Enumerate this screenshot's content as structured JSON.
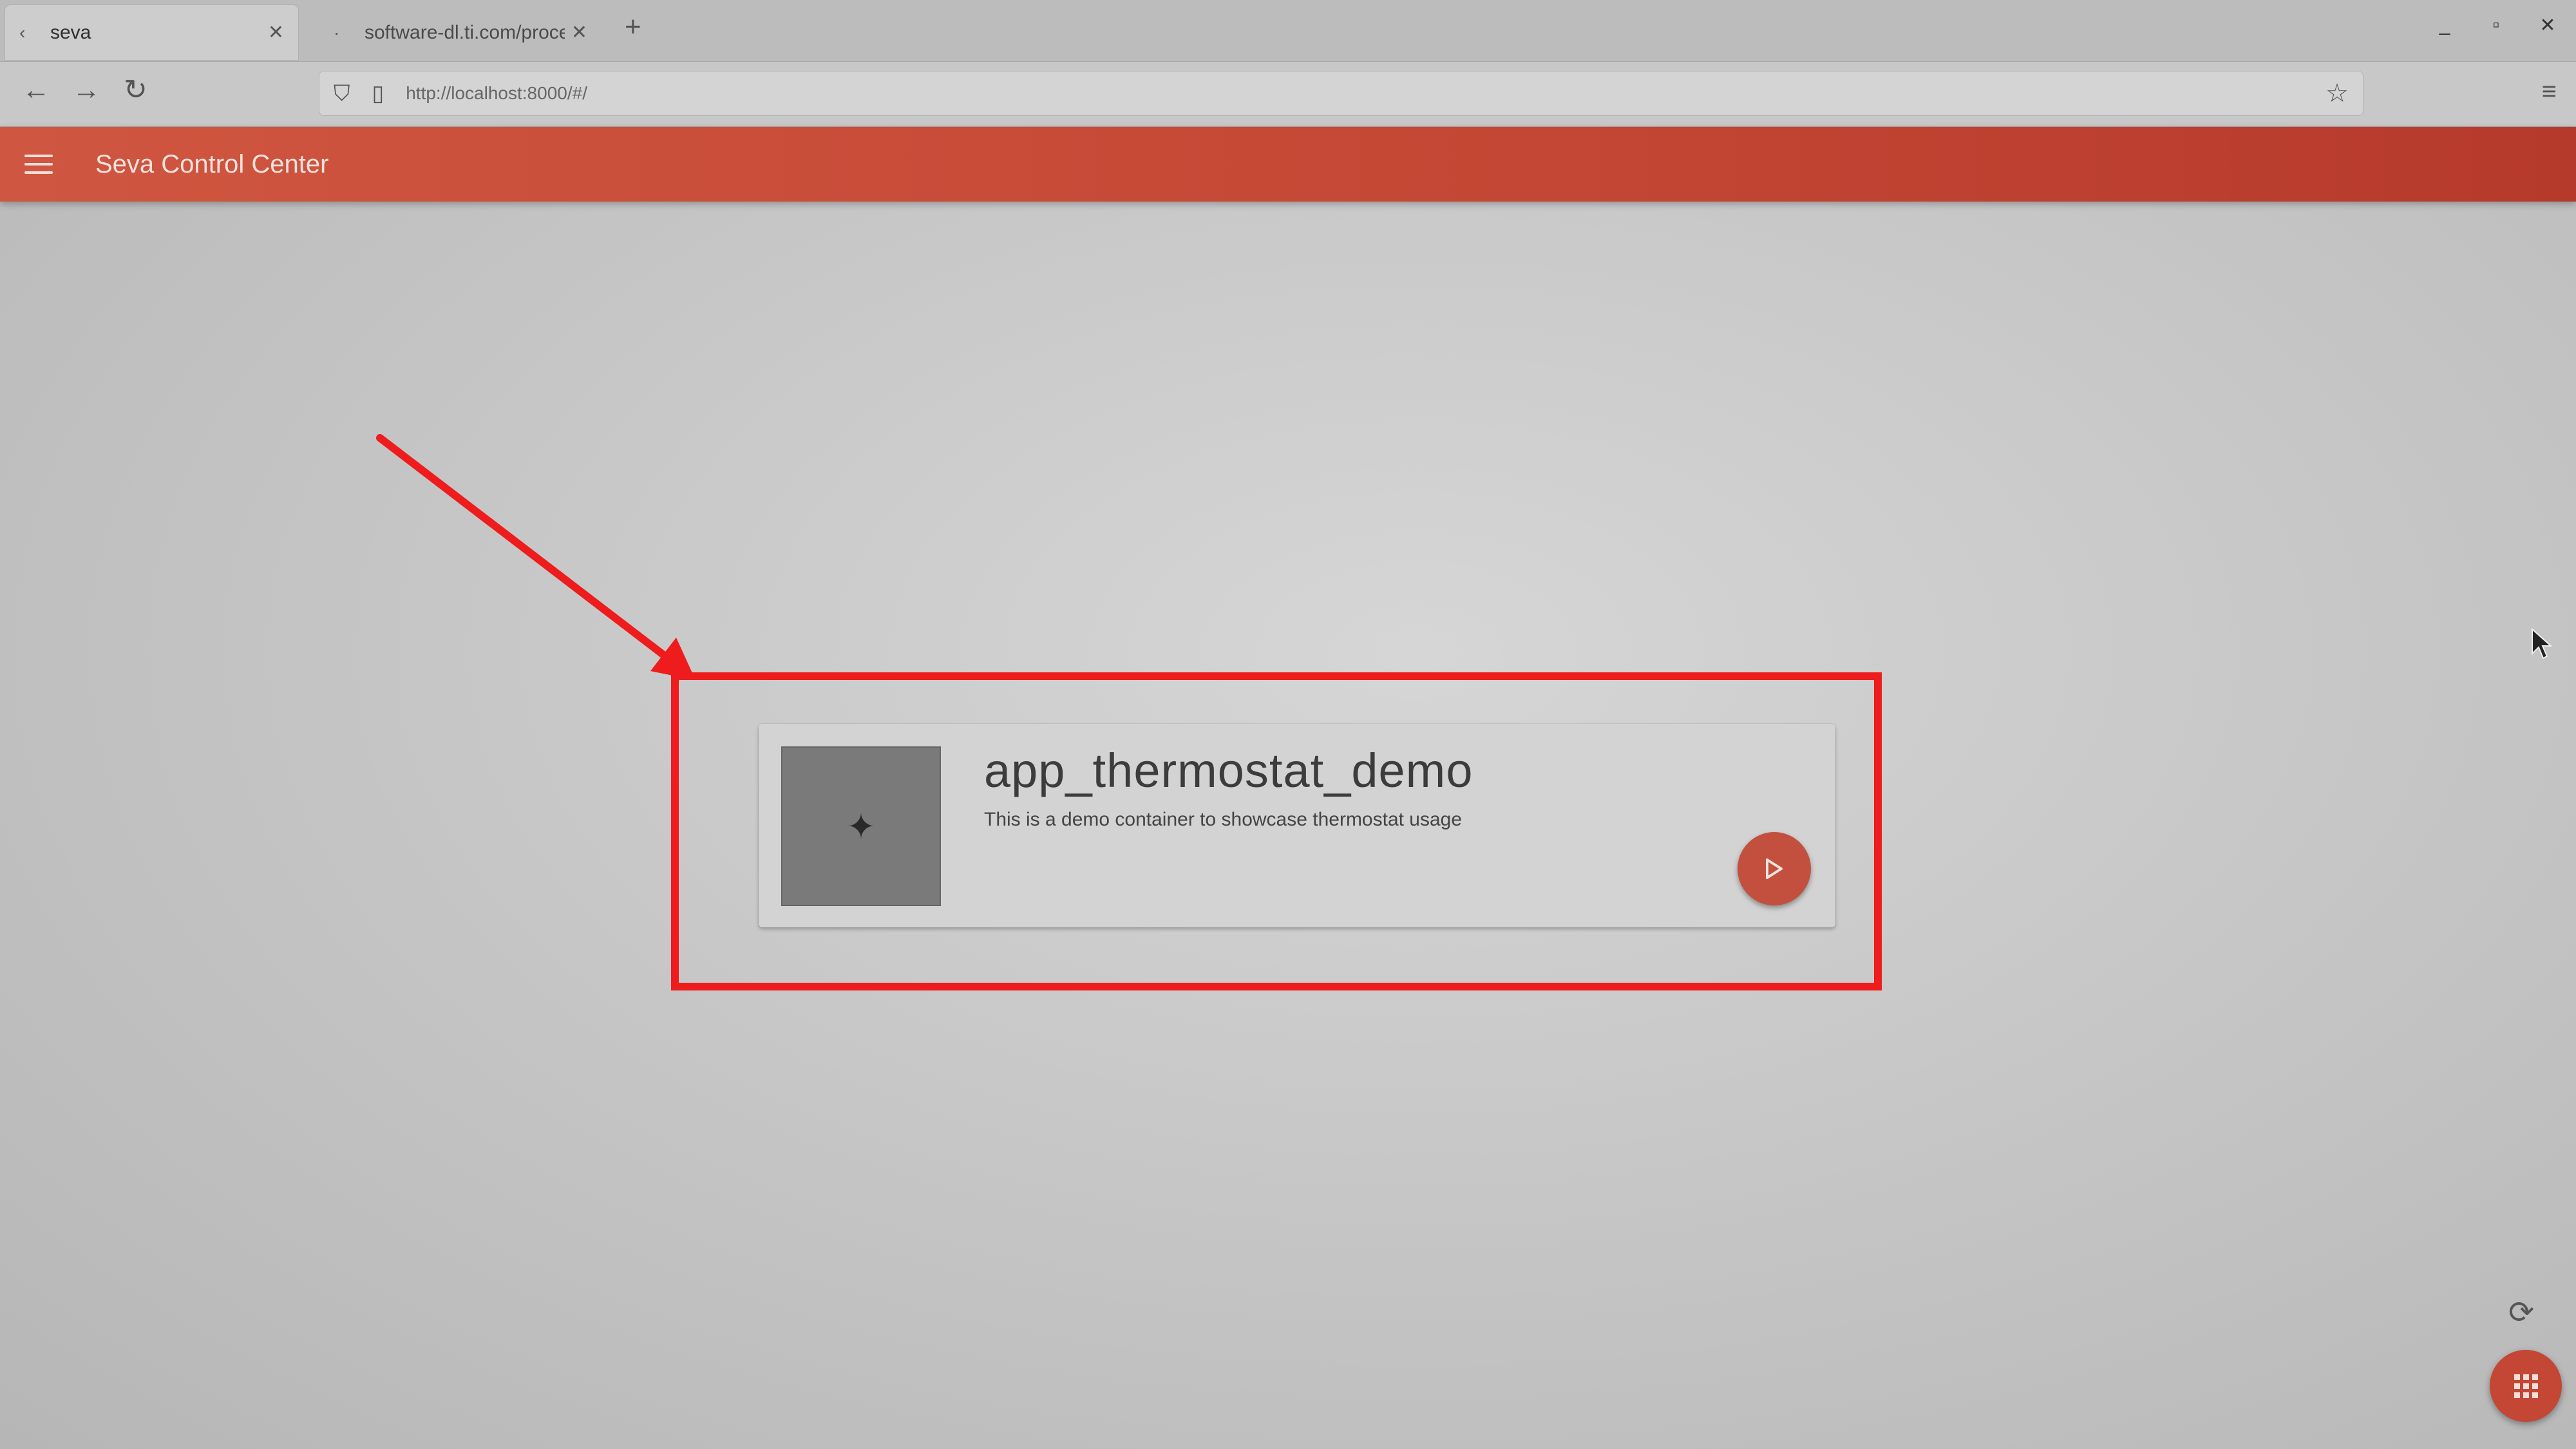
{
  "browser": {
    "tabs": [
      {
        "label": "seva",
        "active": true
      },
      {
        "label": "software-dl.ti.com/proces",
        "active": false
      }
    ],
    "new_tab": "+",
    "close_glyph": "✕",
    "window_controls": {
      "minimize": "_",
      "maximize": "▫",
      "close": "✕"
    },
    "nav": {
      "back": "←",
      "forward": "→",
      "reload": "↻"
    },
    "address": "http://localhost:8000/#/",
    "bookmark": "☆",
    "menu": "≡"
  },
  "app": {
    "title": "Seva Control Center",
    "accent_color": "#c44634"
  },
  "apps": [
    {
      "name": "app_thermostat_demo",
      "description": "This is a demo container to showcase thermostat usage",
      "icon": "sparkle-icon"
    }
  ],
  "annotation": {
    "color": "#ee1c1c"
  },
  "controls": {
    "refresh": "⟳"
  }
}
